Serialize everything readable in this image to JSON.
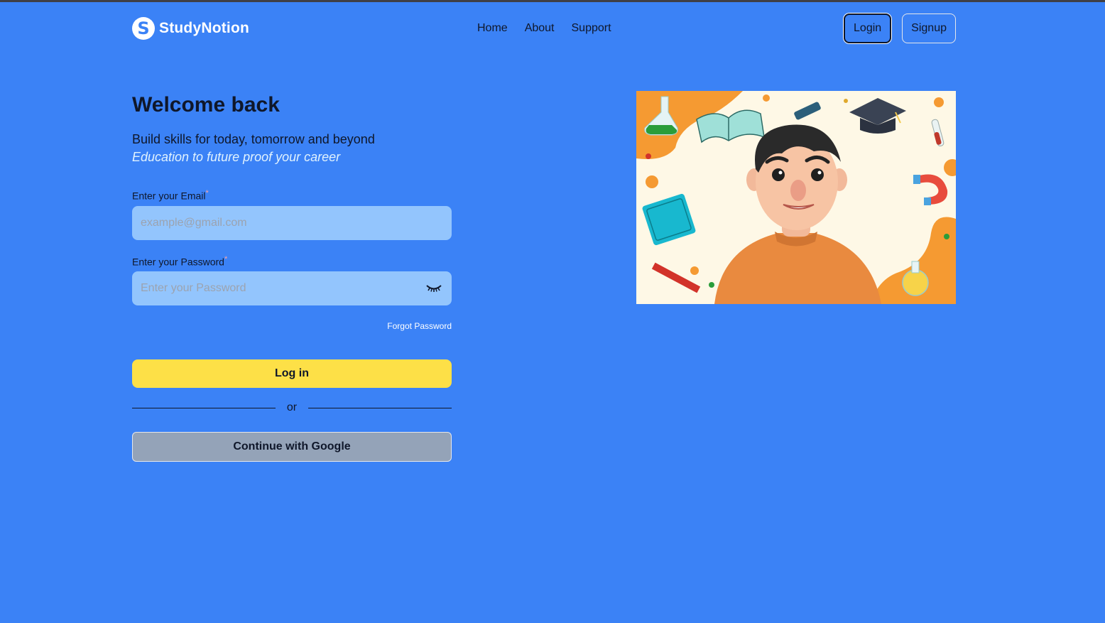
{
  "brand": {
    "name": "StudyNotion",
    "logo_letter": "S"
  },
  "nav": {
    "links": [
      "Home",
      "About",
      "Support"
    ],
    "login_label": "Login",
    "signup_label": "Signup"
  },
  "form": {
    "title": "Welcome back",
    "subtitle": "Build skills for today, tomorrow and beyond",
    "tagline": "Education to future proof your career",
    "email_label": "Enter your Email",
    "email_placeholder": "example@gmail.com",
    "password_label": "Enter your Password",
    "password_placeholder": "Enter your Password",
    "required_mark": "*",
    "forgot_label": "Forgot Password",
    "login_button": "Log in",
    "divider_text": "or",
    "google_button": "Continue with Google"
  },
  "icons": {
    "logo": "logo-s-icon",
    "password_toggle": "eye-closed-icon"
  },
  "colors": {
    "background": "#3b82f6",
    "input_bg": "#93c5fd",
    "primary_button": "#fde047",
    "google_button": "#94a3b8",
    "tagline": "#e0f2fe"
  }
}
